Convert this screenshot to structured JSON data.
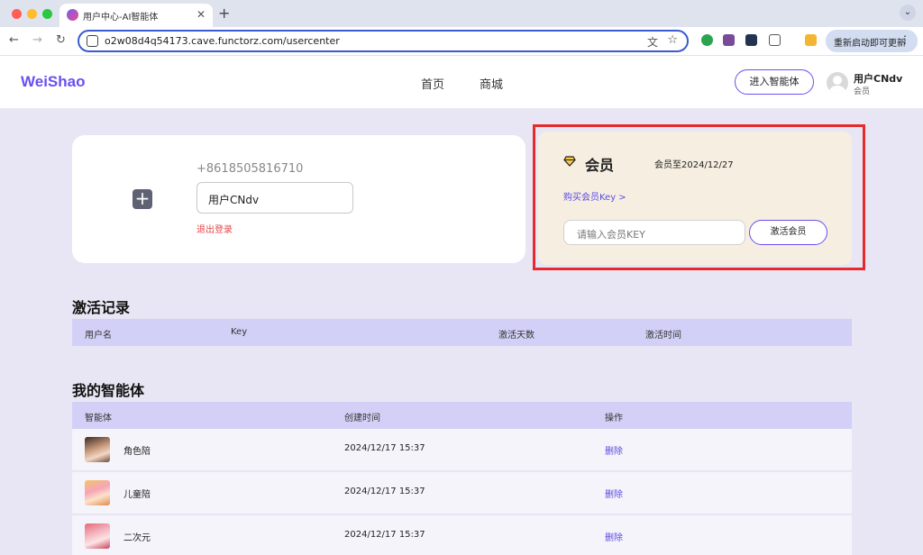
{
  "browser": {
    "tab_title": "用户中心-AI智能体",
    "url": "o2w08d4q54173.cave.functorz.com/usercenter",
    "update_label": "重新启动即可更新"
  },
  "header": {
    "logo": "WeiShao",
    "nav": [
      "首页",
      "商城"
    ],
    "enter_label": "进入智能体",
    "username": "用户CNdv",
    "role": "会员"
  },
  "profile": {
    "phone": "+8618505816710",
    "username": "用户CNdv",
    "logout_label": "退出登录"
  },
  "membership": {
    "title": "会员",
    "expiry": "会员至2024/12/27",
    "buy_key_label": "购买会员Key >",
    "key_placeholder": "请输入会员KEY",
    "activate_label": "激活会员",
    "accent_color": "#6a4ef0",
    "highlight_color": "#e52b2b"
  },
  "activation_records": {
    "title": "激活记录",
    "columns": [
      "用户名",
      "Key",
      "激活天数",
      "激活时间"
    ]
  },
  "my_agents": {
    "title": "我的智能体",
    "columns": [
      "智能体",
      "创建时间",
      "操作"
    ],
    "rows": [
      {
        "name": "角色陪",
        "created": "2024/12/17 15:37",
        "action": "删除"
      },
      {
        "name": "儿童陪",
        "created": "2024/12/17 15:37",
        "action": "删除"
      },
      {
        "name": "二次元",
        "created": "2024/12/17 15:37",
        "action": "删除"
      }
    ]
  }
}
